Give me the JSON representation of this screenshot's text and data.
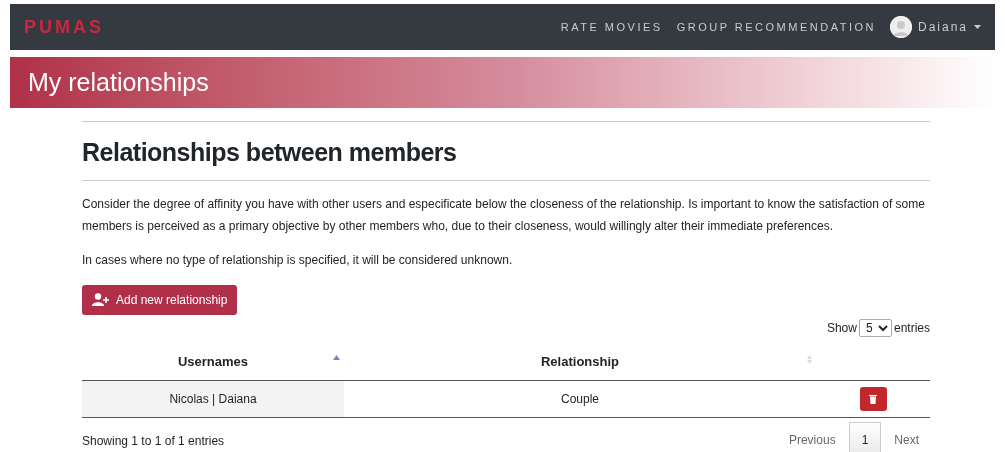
{
  "navbar": {
    "brand": "PUMAS",
    "links": [
      "RATE MOVIES",
      "GROUP RECOMMENDATION"
    ],
    "user": "Daiana"
  },
  "banner": {
    "title": "My relationships"
  },
  "section": {
    "heading": "Relationships between members",
    "paragraphs": [
      "Consider the degree of affinity you have with other users and especificate below the closeness of the relationship. Is important to know the satisfaction of some members is perceived as a primary objective by other members who, due to their closeness, would willingly alter their immediate preferences.",
      "In cases where no type of relationship is specified, it will be considered unknown."
    ],
    "add_button": "Add new relationship"
  },
  "table": {
    "length": {
      "before": "Show",
      "value": "5",
      "after": "entries"
    },
    "columns": [
      {
        "label": "Usernames",
        "sorted": true
      },
      {
        "label": "Relationship",
        "sorted": false
      }
    ],
    "rows": [
      {
        "usernames": "Nicolas | Daiana",
        "relationship": "Couple"
      }
    ],
    "info": "Showing 1 to 1 of 1 entries",
    "pagination": [
      {
        "label": "Previous",
        "selected": false
      },
      {
        "label": "1",
        "selected": true
      },
      {
        "label": "Next",
        "selected": false
      }
    ]
  }
}
